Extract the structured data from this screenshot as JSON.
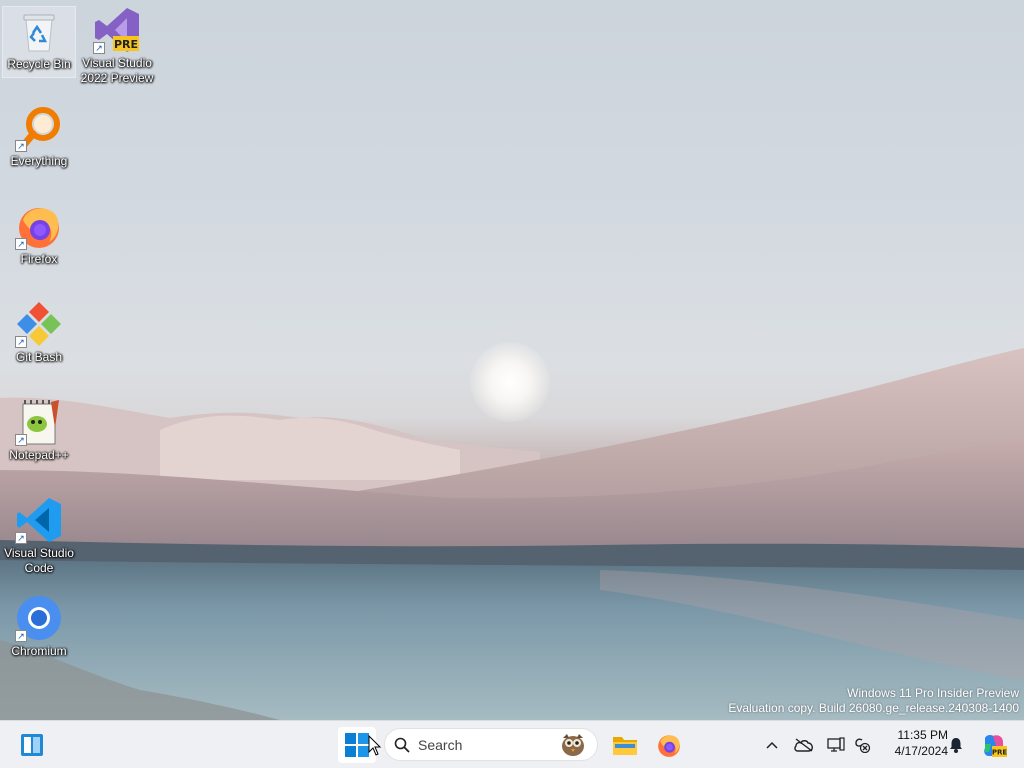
{
  "desktop": {
    "icons": [
      {
        "label": "Recycle Bin",
        "icon": "recycle-bin-icon"
      },
      {
        "label": "Visual Studio\n2022 Preview",
        "icon": "visual-studio-preview-icon",
        "badge": "PRE"
      },
      {
        "label": "Everything",
        "icon": "everything-search-icon"
      },
      {
        "label": "Firefox",
        "icon": "firefox-icon"
      },
      {
        "label": "Git Bash",
        "icon": "git-bash-icon"
      },
      {
        "label": "Notepad++",
        "icon": "notepad-plus-plus-icon"
      },
      {
        "label": "Visual Studio\nCode",
        "icon": "vscode-icon"
      },
      {
        "label": "Chromium",
        "icon": "chromium-icon"
      }
    ],
    "watermark": {
      "line1": "Windows 11 Pro Insider Preview",
      "line2": "Evaluation copy. Build 26080.ge_release.240308-1400"
    }
  },
  "taskbar": {
    "search_placeholder": "Search",
    "pinned": [
      "widgets-icon",
      "start-icon",
      "search-icon",
      "file-explorer-icon",
      "firefox-icon"
    ],
    "tray": [
      "show-hidden-icons-chevron",
      "onedrive-icon",
      "display-icon",
      "network-icon",
      "notification-bell-icon",
      "copilot-icon"
    ],
    "copilot_badge": "PRE",
    "clock": {
      "time": "11:35 PM",
      "date": "4/17/2024"
    }
  },
  "colors": {
    "accent": "#0078d4",
    "taskbar_bg": "#eef0f3"
  }
}
